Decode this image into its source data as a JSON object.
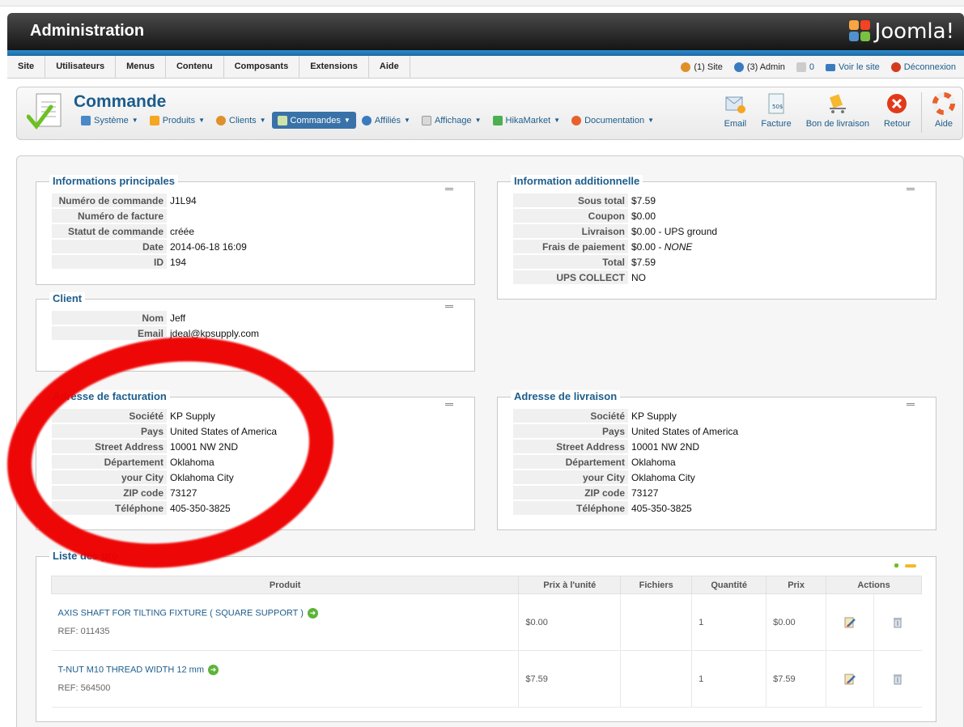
{
  "header": {
    "title": "Administration",
    "logo_text": "Joomla!"
  },
  "menu": {
    "items": [
      "Site",
      "Utilisateurs",
      "Menus",
      "Contenu",
      "Composants",
      "Extensions",
      "Aide"
    ],
    "status": {
      "site": "(1) Site",
      "admin": "(3) Admin",
      "messages": "0",
      "view_site": "Voir le site",
      "logout": "Déconnexion"
    }
  },
  "toolbar": {
    "page_title": "Commande",
    "submenu": [
      "Système",
      "Produits",
      "Clients",
      "Commandes",
      "Affiliés",
      "Affichage",
      "HikaMarket",
      "Documentation"
    ],
    "active_submenu": "Commandes",
    "buttons": {
      "email": "Email",
      "facture": "Facture",
      "livraison": "Bon de livraison",
      "retour": "Retour",
      "aide": "Aide"
    }
  },
  "main_info": {
    "legend": "Informations principales",
    "rows": [
      {
        "k": "Numéro de commande",
        "v": "J1L94"
      },
      {
        "k": "Numéro de facture",
        "v": ""
      },
      {
        "k": "Statut de commande",
        "v": "créée"
      },
      {
        "k": "Date",
        "v": "2014-06-18 16:09"
      },
      {
        "k": "ID",
        "v": "194"
      }
    ]
  },
  "additional": {
    "legend": "Information additionnelle",
    "rows": [
      {
        "k": "Sous total",
        "v": "$7.59"
      },
      {
        "k": "Coupon",
        "v": "$0.00"
      },
      {
        "k": "Livraison",
        "v": "$0.00 - UPS ground"
      },
      {
        "k": "Frais de paiement",
        "v": "$0.00 - ",
        "v_italic": "NONE"
      },
      {
        "k": "Total",
        "v": "$7.59"
      },
      {
        "k": "UPS COLLECT",
        "v": "NO"
      }
    ]
  },
  "client": {
    "legend": "Client",
    "rows": [
      {
        "k": "Nom",
        "v": "Jeff"
      },
      {
        "k": "Email",
        "v": "jdeal@kpsupply.com"
      }
    ]
  },
  "billing": {
    "legend": "Adresse de facturation",
    "rows": [
      {
        "k": "Société",
        "v": "KP Supply"
      },
      {
        "k": "Pays",
        "v": "United States of America"
      },
      {
        "k": "Street Address",
        "v": "10001 NW 2ND"
      },
      {
        "k": "Département",
        "v": "Oklahoma"
      },
      {
        "k": "your City",
        "v": "Oklahoma City"
      },
      {
        "k": "ZIP code",
        "v": "73127"
      },
      {
        "k": "Téléphone",
        "v": "405-350-3825"
      }
    ]
  },
  "shipping": {
    "legend": "Adresse de livraison",
    "rows": [
      {
        "k": "Société",
        "v": "KP Supply"
      },
      {
        "k": "Pays",
        "v": "United States of America"
      },
      {
        "k": "Street Address",
        "v": "10001 NW 2ND"
      },
      {
        "k": "Département",
        "v": "Oklahoma"
      },
      {
        "k": "your City",
        "v": "Oklahoma City"
      },
      {
        "k": "ZIP code",
        "v": "73127"
      },
      {
        "k": "Téléphone",
        "v": "405-350-3825"
      }
    ]
  },
  "products": {
    "legend": "Liste des pro",
    "headers": [
      "Produit",
      "Prix à l'unité",
      "Fichiers",
      "Quantité",
      "Prix",
      "Actions"
    ],
    "rows": [
      {
        "name": "AXIS SHAFT FOR TILTING FIXTURE ( SQUARE SUPPORT )",
        "ref": "REF: 011435",
        "unit": "$0.00",
        "files": "",
        "qty": "1",
        "price": "$0.00"
      },
      {
        "name": "T-NUT M10 THREAD WIDTH 12 mm",
        "ref": "REF: 564500",
        "unit": "$7.59",
        "files": "",
        "qty": "1",
        "price": "$7.59"
      }
    ]
  },
  "colors": {
    "annotation_oval": "#ee0000",
    "link": "#1d5d8c",
    "active_tab": "#3872a8"
  }
}
